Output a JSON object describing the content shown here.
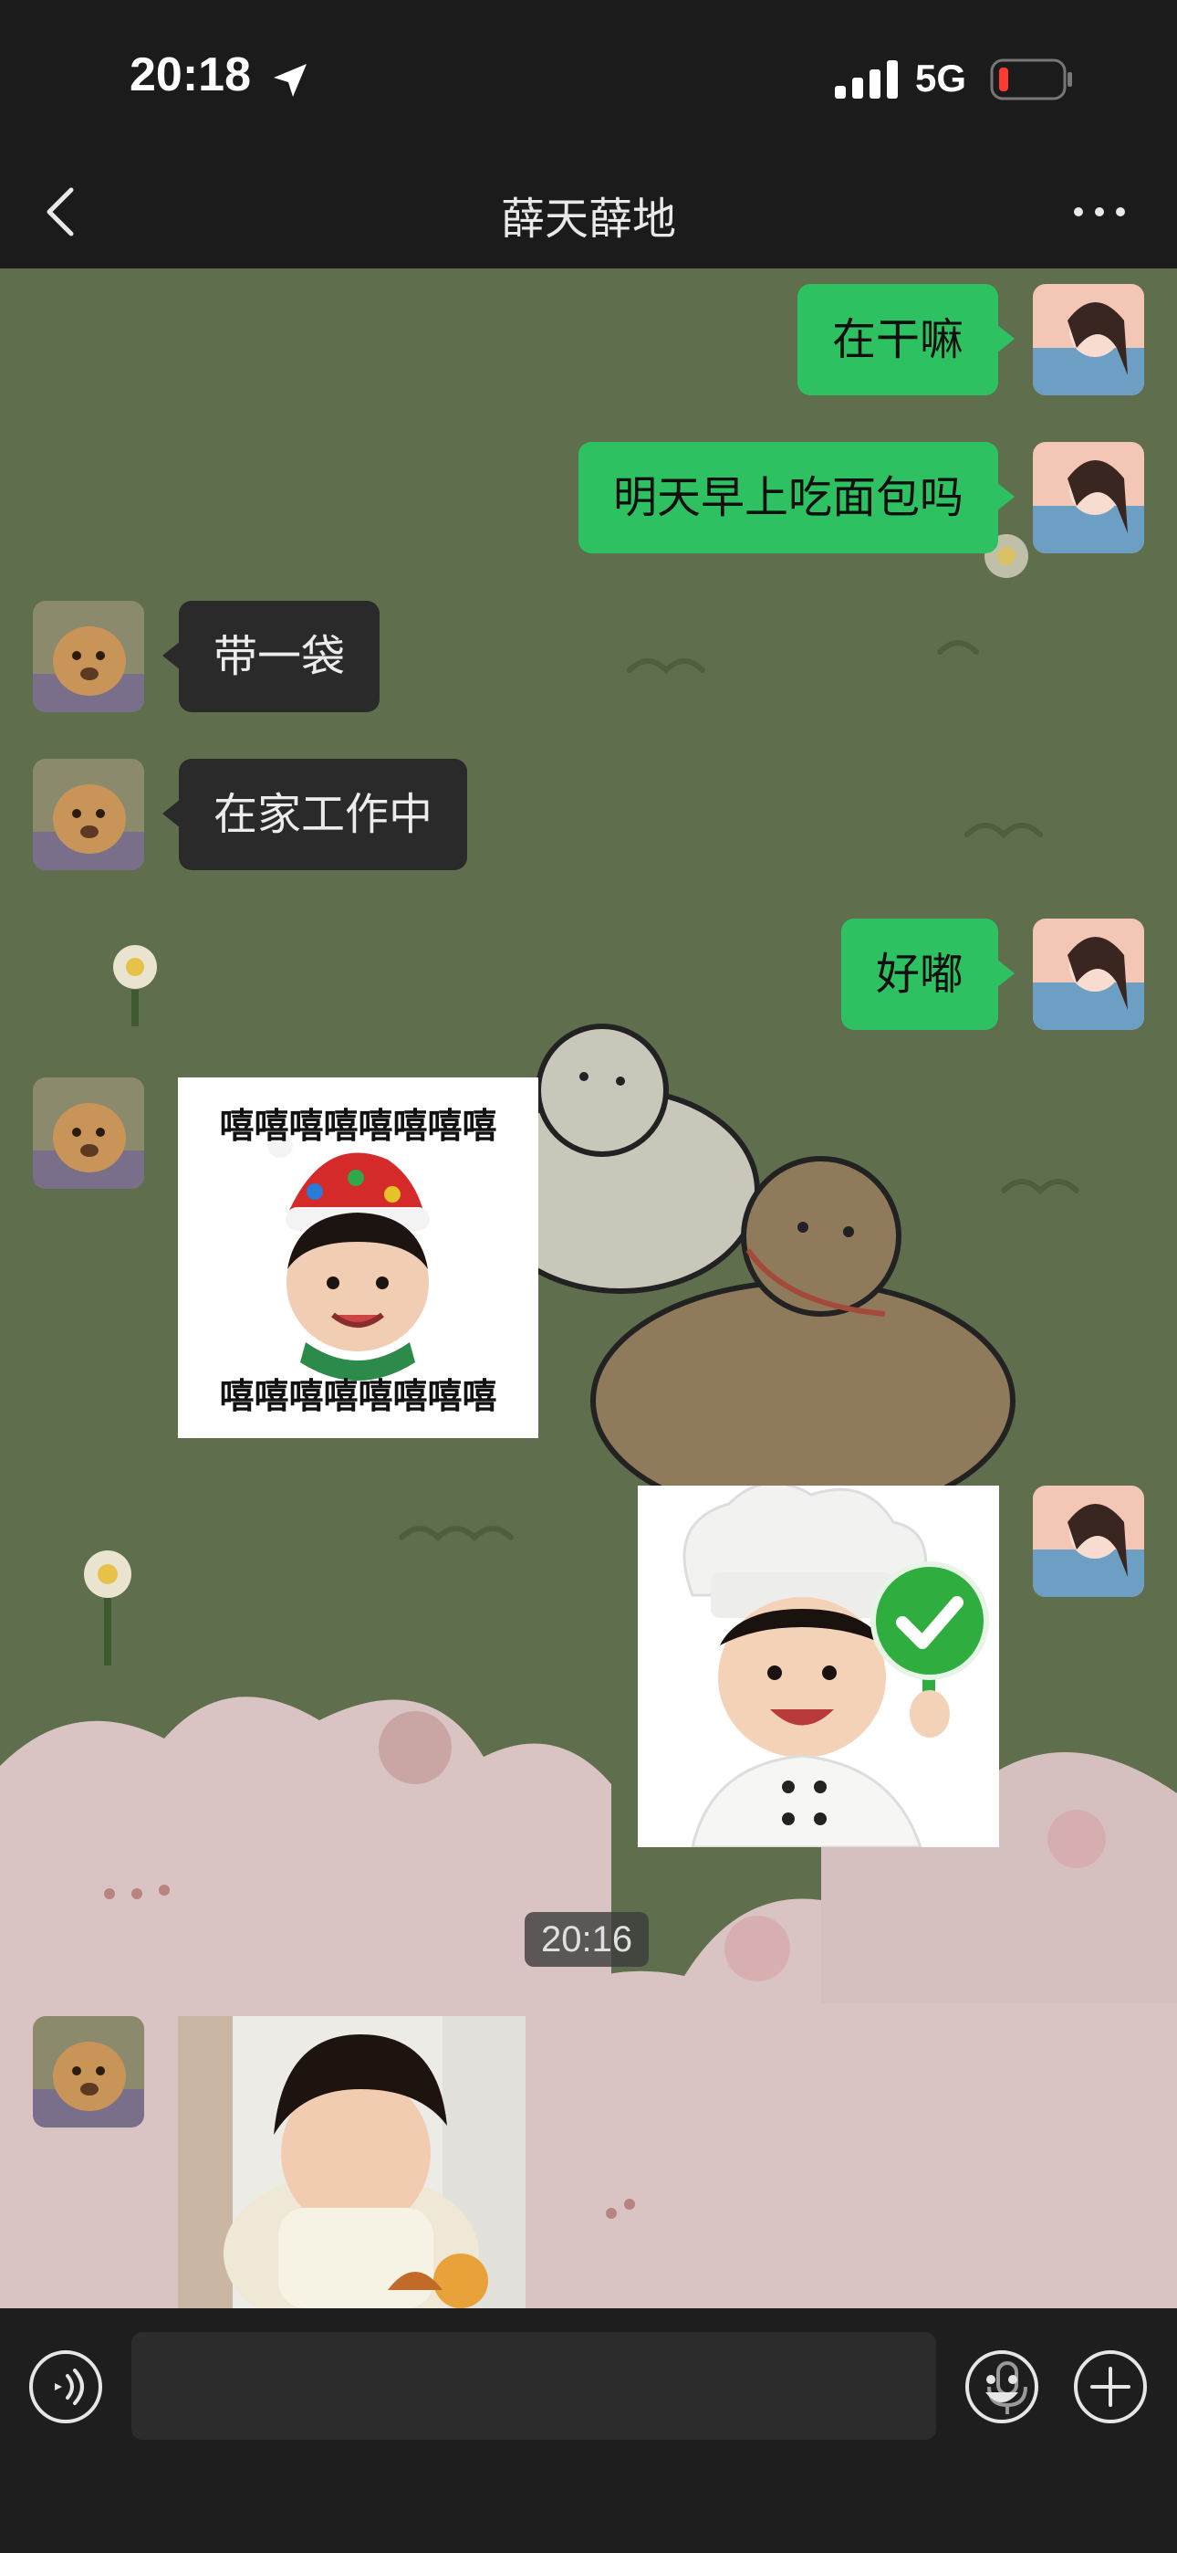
{
  "status_bar": {
    "time": "20:18",
    "network": "5G",
    "icons": [
      "location-arrow-icon",
      "cellular-signal-icon",
      "battery-low-icon"
    ],
    "battery_color": "#ff3b30"
  },
  "nav": {
    "title": "薛天薛地",
    "back_icon": "chevron-left-icon",
    "more_icon": "more-dots-icon"
  },
  "colors": {
    "outgoing_bubble": "#2ec162",
    "incoming_bubble": "#2a2a2a",
    "chat_background": "#5f6f4d"
  },
  "messages": [
    {
      "id": "m1",
      "direction": "out",
      "type": "text",
      "text": "在干嘛"
    },
    {
      "id": "m2",
      "direction": "out",
      "type": "text",
      "text": "明天早上吃面包吗"
    },
    {
      "id": "m3",
      "direction": "in",
      "type": "text",
      "text": "带一袋"
    },
    {
      "id": "m4",
      "direction": "in",
      "type": "text",
      "text": "在家工作中"
    },
    {
      "id": "m5",
      "direction": "out",
      "type": "text",
      "text": "好嘟"
    },
    {
      "id": "m6",
      "direction": "in",
      "type": "sticker",
      "caption_top": "嘻嘻嘻嘻嘻嘻嘻嘻",
      "caption_bottom": "嘻嘻嘻嘻嘻嘻嘻嘻"
    },
    {
      "id": "m7",
      "direction": "out",
      "type": "sticker"
    },
    {
      "id": "m8",
      "direction": "in",
      "type": "image"
    }
  ],
  "timestamp": "20:16",
  "input_bar": {
    "placeholder": "",
    "icons": [
      "voice-toggle-icon",
      "microphone-icon",
      "emoji-icon",
      "plus-icon"
    ]
  }
}
